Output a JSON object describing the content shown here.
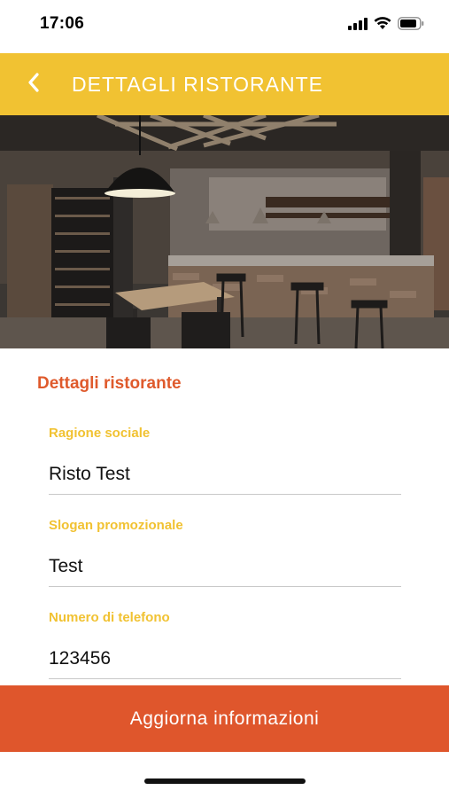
{
  "status_bar": {
    "time": "17:06",
    "icons": [
      "signal-icon",
      "wifi-icon",
      "battery-icon"
    ]
  },
  "header": {
    "back_icon": "chevron-left-icon",
    "title": "DETTAGLI RISTORANTE",
    "background_color": "#f1c232"
  },
  "hero_image": {
    "subject": "restaurant interior photo"
  },
  "form": {
    "section_title": "Dettagli ristorante",
    "fields": [
      {
        "label": "Ragione sociale",
        "value": "Risto Test"
      },
      {
        "label": "Slogan promozionale",
        "value": "Test"
      },
      {
        "label": "Numero di telefono",
        "value": "123456"
      }
    ]
  },
  "actions": {
    "update_label": "Aggiorna informazioni",
    "button_color": "#df562c"
  },
  "colors": {
    "accent_yellow": "#f1c232",
    "accent_orange": "#df5a2c"
  }
}
